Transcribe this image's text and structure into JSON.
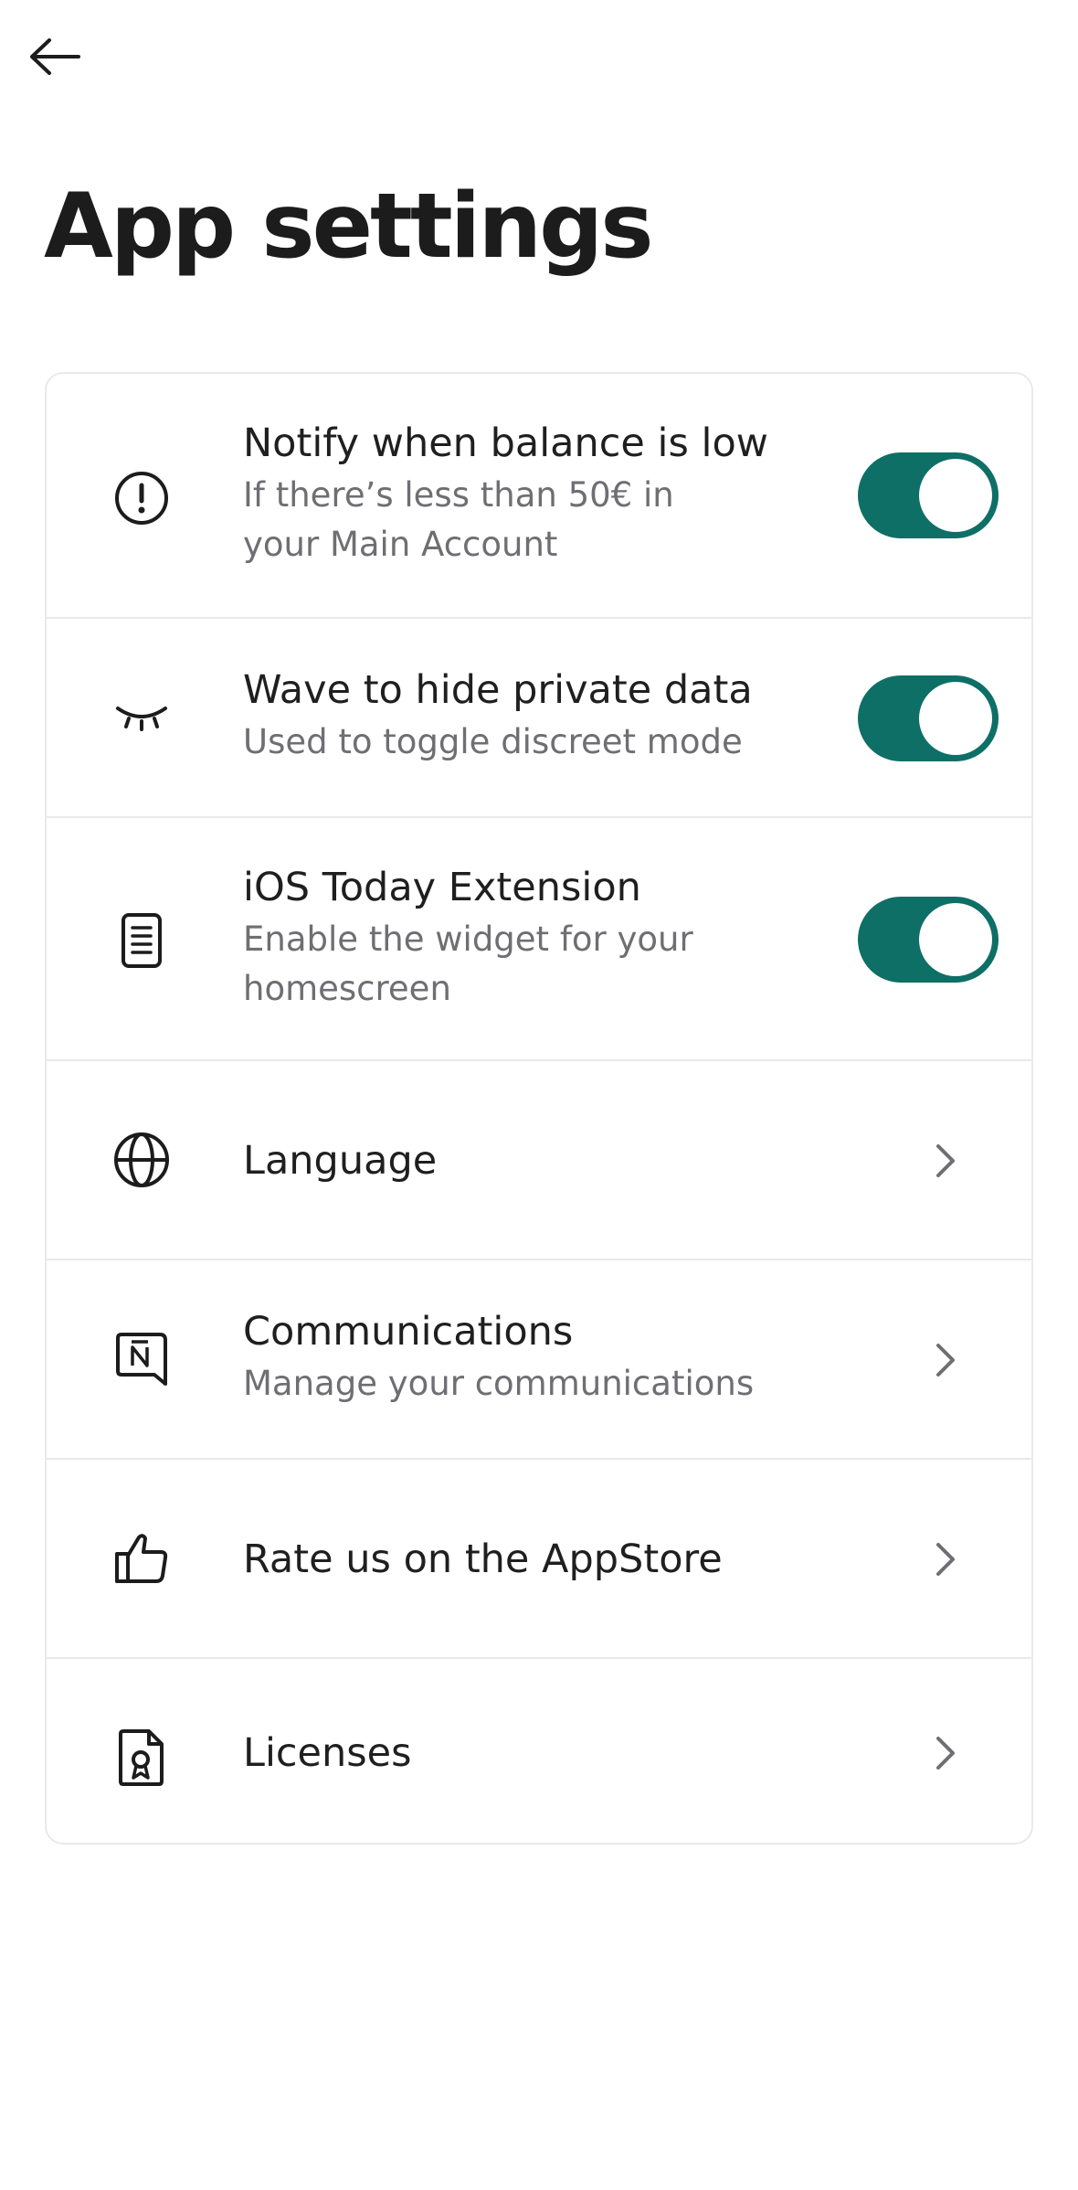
{
  "header": {
    "back_icon": "arrow-left-icon",
    "title": "App settings"
  },
  "settings": {
    "low_balance": {
      "icon": "alert-circle-icon",
      "title": "Notify when balance is low",
      "subtitle": "If there’s less than 50€ in your Main Account",
      "enabled": true
    },
    "wave_hide": {
      "icon": "closed-eye-icon",
      "title": "Wave to hide private data",
      "subtitle": "Used to toggle discreet mode",
      "enabled": true
    },
    "today_extension": {
      "icon": "widget-document-icon",
      "title": "iOS Today Extension",
      "subtitle": "Enable the widget for your homescreen",
      "enabled": true
    },
    "language": {
      "icon": "globe-icon",
      "title": "Language"
    },
    "communications": {
      "icon": "message-n-icon",
      "title": "Communications",
      "subtitle": "Manage your communications"
    },
    "rate": {
      "icon": "thumbs-up-icon",
      "title": "Rate us on the AppStore"
    },
    "licenses": {
      "icon": "certificate-icon",
      "title": "Licenses"
    }
  },
  "colors": {
    "toggle_on": "#0e6f66",
    "text_primary": "#1f1f1f",
    "text_secondary": "#6e6e73",
    "divider": "#e9e9ea"
  }
}
